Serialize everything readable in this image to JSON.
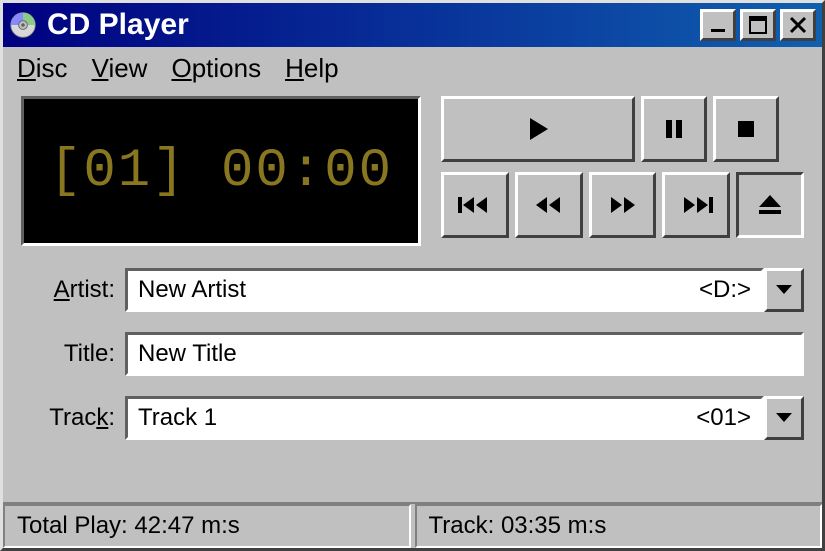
{
  "titlebar": {
    "title": "CD Player"
  },
  "menubar": {
    "disc": "Disc",
    "view": "View",
    "options": "Options",
    "help": "Help"
  },
  "display": {
    "track_number": "01",
    "time": "00:00"
  },
  "transport": {
    "play": "Play",
    "pause": "Pause",
    "stop": "Stop",
    "skip_prev": "Previous Track",
    "rewind": "Rewind",
    "ffwd": "Fast Forward",
    "skip_next": "Next Track",
    "eject": "Eject"
  },
  "fields": {
    "artist_label": "Artist:",
    "artist_value": "New Artist",
    "artist_index": "<D:>",
    "title_label": "Title:",
    "title_value": "New Title",
    "track_label": "Track:",
    "track_value": "Track 1",
    "track_index": "<01>"
  },
  "status": {
    "total_play": "Total Play: 42:47 m:s",
    "track_time": "Track: 03:35 m:s"
  }
}
